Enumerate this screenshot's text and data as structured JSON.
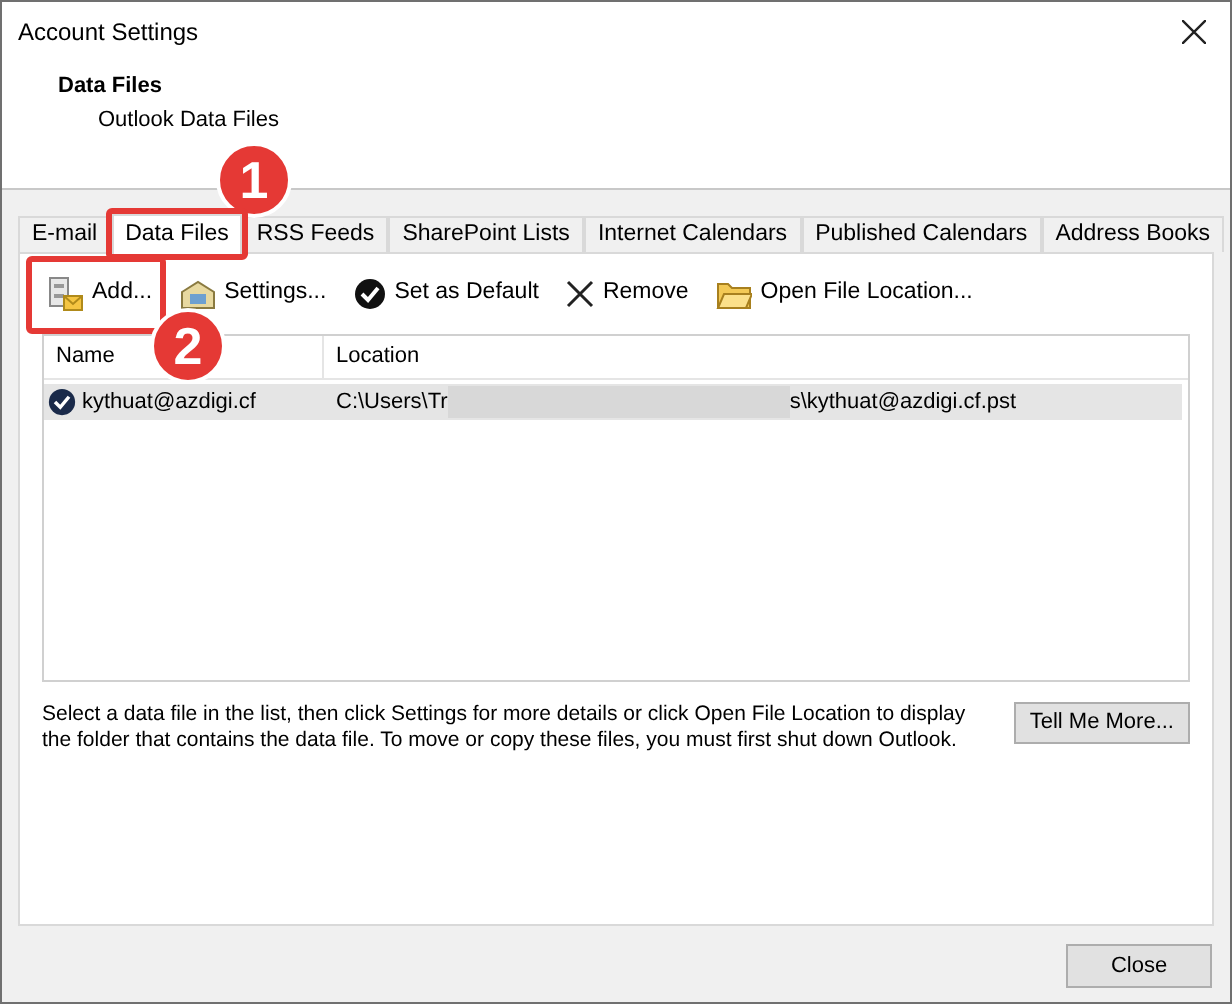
{
  "window": {
    "title": "Account Settings"
  },
  "header": {
    "title": "Data Files",
    "subtitle": "Outlook Data Files"
  },
  "tabs": [
    {
      "label": "E-mail",
      "selected": false,
      "highlighted": false
    },
    {
      "label": "Data Files",
      "selected": true,
      "highlighted": true
    },
    {
      "label": "RSS Feeds",
      "selected": false,
      "highlighted": false
    },
    {
      "label": "SharePoint Lists",
      "selected": false,
      "highlighted": false
    },
    {
      "label": "Internet Calendars",
      "selected": false,
      "highlighted": false
    },
    {
      "label": "Published Calendars",
      "selected": false,
      "highlighted": false
    },
    {
      "label": "Address Books",
      "selected": false,
      "highlighted": false
    }
  ],
  "toolbar": [
    {
      "kind": "add",
      "label": "Add...",
      "highlighted": true
    },
    {
      "kind": "settings",
      "label": "Settings...",
      "highlighted": false
    },
    {
      "kind": "default",
      "label": "Set as Default",
      "highlighted": false
    },
    {
      "kind": "remove",
      "label": "Remove",
      "highlighted": false
    },
    {
      "kind": "open",
      "label": "Open File Location...",
      "highlighted": false
    }
  ],
  "table": {
    "columns": [
      "Name",
      "Location"
    ],
    "rows": [
      {
        "name": "kythuat@azdigi.cf",
        "location_start": "C:\\Users\\Tr",
        "location_end": "s\\kythuat@azdigi.cf.pst",
        "default": true,
        "selected": true
      }
    ]
  },
  "description": "Select a data file in the list, then click Settings for more details or click Open File Location to display the folder that contains the data file. To move or copy these files, you must first shut down Outlook.",
  "tell_me_more": "Tell Me More...",
  "close": "Close",
  "callouts": [
    {
      "number": "1"
    },
    {
      "number": "2"
    }
  ]
}
